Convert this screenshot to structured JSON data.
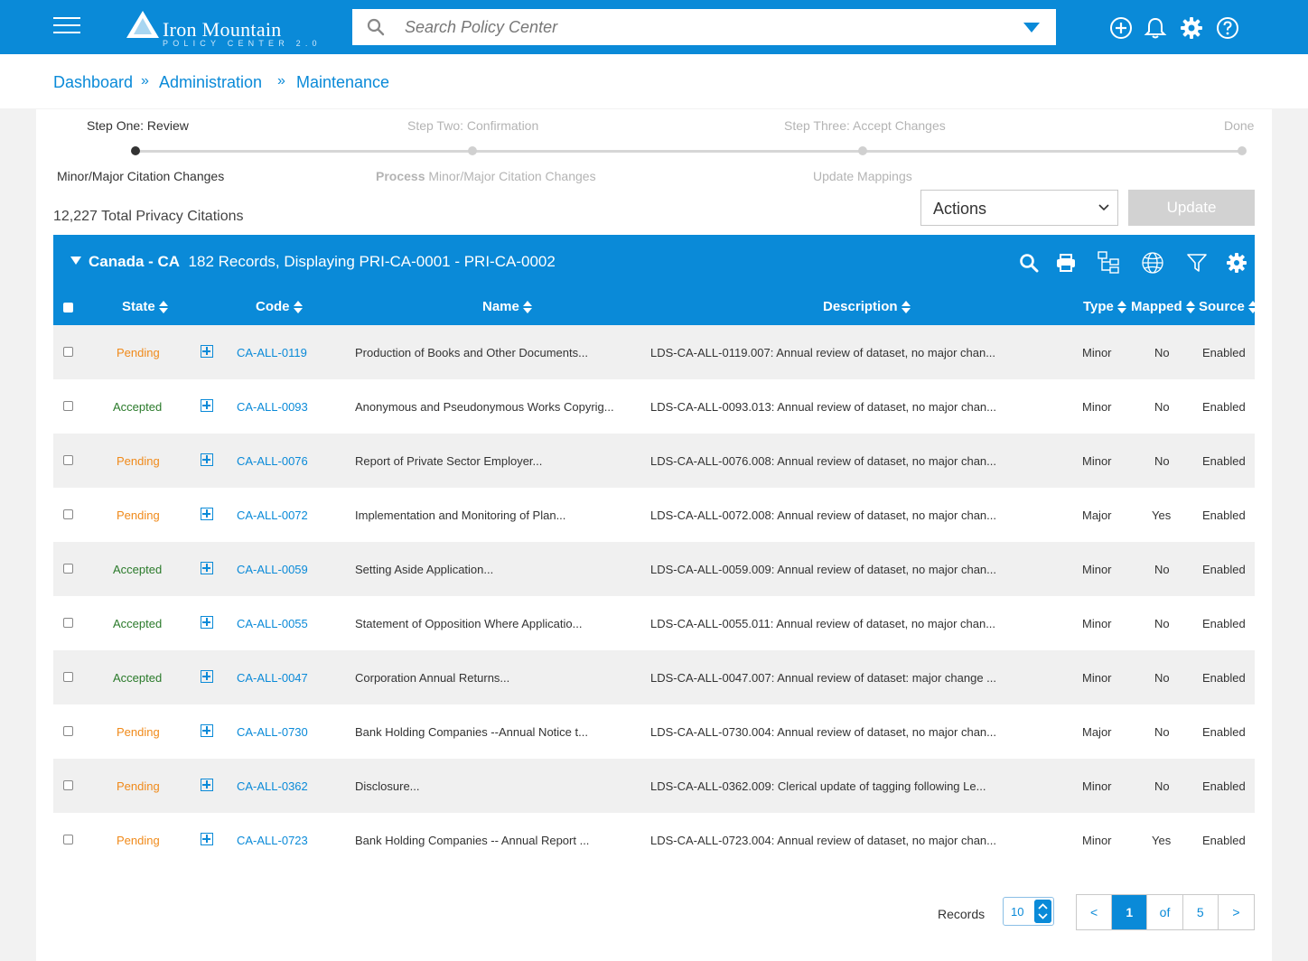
{
  "header": {
    "logo_main": "Iron Mountain",
    "logo_sub": "POLICY CENTER 2.0",
    "search_placeholder": "Search Policy Center",
    "icons": [
      "add-circle-icon",
      "bell-icon",
      "gear-icon",
      "help-icon"
    ]
  },
  "breadcrumb": {
    "items": [
      "Dashboard",
      "Administration",
      "Maintenance"
    ],
    "separator": "»"
  },
  "stepper": {
    "steps": [
      {
        "label": "Step One: Review",
        "sub": "Minor/Major Citation Changes",
        "active": true
      },
      {
        "label": "Step Two: Confirmation",
        "sub_bold": "Process",
        "sub": "Minor/Major Citation Changes",
        "active": false
      },
      {
        "label": "Step Three: Accept Changes",
        "sub": "Update Mappings",
        "active": false
      },
      {
        "label": "Done",
        "sub": "",
        "active": false
      }
    ]
  },
  "summary": {
    "total": "12,227 Total Privacy Citations",
    "actions_label": "Actions",
    "update_label": "Update"
  },
  "table": {
    "group_name": "Canada - CA",
    "group_info": "182 Records, Displaying PRI-CA-0001 - PRI-CA-0002",
    "tools": [
      "search-icon",
      "print-icon",
      "hierarchy-icon",
      "globe-icon",
      "filter-icon",
      "gear-icon"
    ],
    "columns": [
      "State",
      "Code",
      "Name",
      "Description",
      "Type",
      "Mapped",
      "Source"
    ],
    "rows": [
      {
        "state": "Pending",
        "code": "CA-ALL-0119",
        "name": "Production of Books and Other Documents...",
        "description": "LDS-CA-ALL-0119.007: Annual review of dataset, no major chan...",
        "type": "Minor",
        "mapped": "No",
        "source": "Enabled"
      },
      {
        "state": "Accepted",
        "code": "CA-ALL-0093",
        "name": "Anonymous and Pseudonymous Works Copyrig...",
        "description": "LDS-CA-ALL-0093.013: Annual review of dataset, no major chan...",
        "type": "Minor",
        "mapped": "No",
        "source": "Enabled"
      },
      {
        "state": "Pending",
        "code": "CA-ALL-0076",
        "name": "Report of Private Sector Employer...",
        "description": "LDS-CA-ALL-0076.008: Annual review of dataset, no major chan...",
        "type": "Minor",
        "mapped": "No",
        "source": "Enabled"
      },
      {
        "state": "Pending",
        "code": "CA-ALL-0072",
        "name": "Implementation and Monitoring of Plan...",
        "description": "LDS-CA-ALL-0072.008: Annual review of dataset, no major chan...",
        "type": "Major",
        "mapped": "Yes",
        "source": "Enabled"
      },
      {
        "state": "Accepted",
        "code": "CA-ALL-0059",
        "name": "Setting Aside Application...",
        "description": "LDS-CA-ALL-0059.009: Annual review of dataset, no major chan...",
        "type": "Minor",
        "mapped": "No",
        "source": "Enabled"
      },
      {
        "state": "Accepted",
        "code": "CA-ALL-0055",
        "name": "Statement of Opposition Where Applicatio...",
        "description": "LDS-CA-ALL-0055.011: Annual review of dataset, no major chan...",
        "type": "Minor",
        "mapped": "No",
        "source": "Enabled"
      },
      {
        "state": "Accepted",
        "code": "CA-ALL-0047",
        "name": "Corporation Annual Returns...",
        "description": "LDS-CA-ALL-0047.007: Annual review of dataset: major change ...",
        "type": "Minor",
        "mapped": "No",
        "source": "Enabled"
      },
      {
        "state": "Pending",
        "code": "CA-ALL-0730",
        "name": "Bank Holding Companies --Annual Notice t...",
        "description": "LDS-CA-ALL-0730.004: Annual review of dataset, no major chan...",
        "type": "Major",
        "mapped": "No",
        "source": "Enabled"
      },
      {
        "state": "Pending",
        "code": "CA-ALL-0362",
        "name": "Disclosure...",
        "description": "LDS-CA-ALL-0362.009: Clerical update of tagging following Le...",
        "type": "Minor",
        "mapped": "No",
        "source": "Enabled"
      },
      {
        "state": "Pending",
        "code": "CA-ALL-0723",
        "name": "Bank Holding Companies -- Annual Report ...",
        "description": "LDS-CA-ALL-0723.004: Annual review of dataset, no major chan...",
        "type": "Minor",
        "mapped": "Yes",
        "source": "Enabled"
      }
    ]
  },
  "pagination": {
    "records_label": "Records",
    "page_size": "10",
    "prev": "<",
    "current": "1",
    "of": "of",
    "total_pages": "5",
    "next": ">"
  },
  "colors": {
    "brand": "#0a8ad8",
    "pending": "#f08a1a",
    "accepted": "#2a7a2a"
  }
}
